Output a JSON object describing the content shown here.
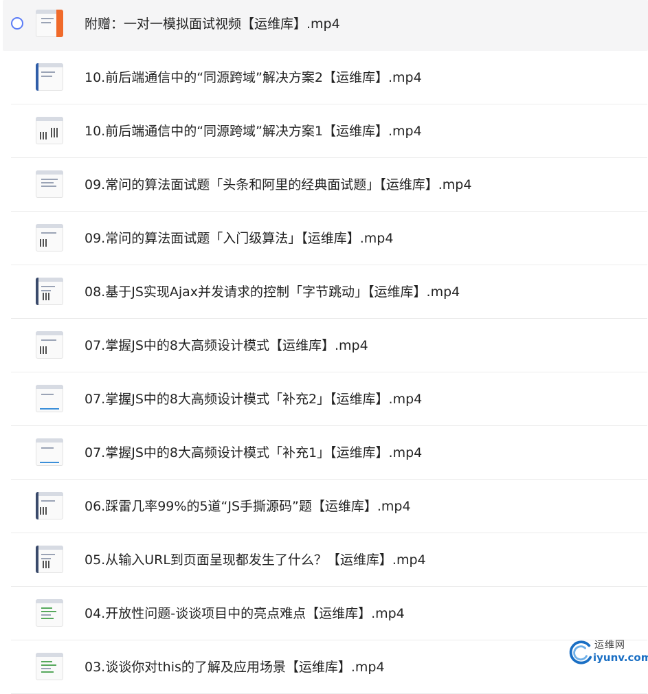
{
  "files": [
    {
      "name": "附赠：一对一模拟面试视频【运维库】.mp4",
      "selected": true,
      "thumb": "orange"
    },
    {
      "name": "10.前后端通信中的“同源跨域”解决方案2【运维库】.mp4",
      "thumb": "blue-side"
    },
    {
      "name": "10.前后端通信中的“同源跨域”解决方案1【运维库】.mp4",
      "thumb": "qr2"
    },
    {
      "name": "09.常问的算法面试题「头条和阿里的经典面试题」【运维库】.mp4",
      "thumb": "lines"
    },
    {
      "name": "09.常问的算法面试题「入门级算法」【运维库】.mp4",
      "thumb": "qr"
    },
    {
      "name": "08.基于JS实现Ajax并发请求的控制「字节跳动」【运维库】.mp4",
      "thumb": "dark-side"
    },
    {
      "name": "07.掌握JS中的8大高频设计模式【运维库】.mp4",
      "thumb": "qr"
    },
    {
      "name": "07.掌握JS中的8大高频设计模式「补充2」【运维库】.mp4",
      "thumb": "blue"
    },
    {
      "name": "07.掌握JS中的8大高频设计模式「补充1」【运维库】.mp4",
      "thumb": "blue"
    },
    {
      "name": "06.踩雷几率99%的5道“JS手撕源码”题【运维库】.mp4",
      "thumb": "qr-dark"
    },
    {
      "name": "05.从输入URL到页面呈现都发生了什么？【运维库】.mp4",
      "thumb": "dark-side"
    },
    {
      "name": "04.开放性问题-谈谈项目中的亮点难点【运维库】.mp4",
      "thumb": "green"
    },
    {
      "name": "03.谈谈你对this的了解及应用场景【运维库】.mp4",
      "thumb": "green"
    }
  ],
  "watermark": {
    "top": "运维网",
    "bottom": "iyunv.com"
  },
  "colors": {
    "radio": "#5b7cf6",
    "selected_row": "#f5f5f6",
    "divider": "#ececec",
    "watermark_blue": "#1a6fc4"
  }
}
